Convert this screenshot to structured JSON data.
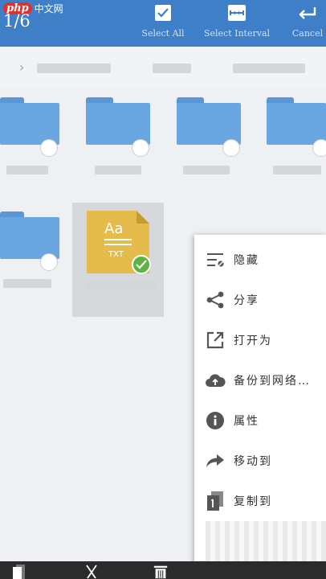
{
  "watermark": {
    "badge": "php",
    "text": "中文网"
  },
  "selection": {
    "counter": "1/6"
  },
  "toolbar": {
    "select_all": {
      "label": "Select All",
      "icon": "checkbox-icon"
    },
    "select_interval": {
      "label": "Select Interval",
      "icon": "interval-icon"
    },
    "cancel": {
      "label": "Cancel",
      "icon": "return-arrow-icon"
    }
  },
  "files": {
    "selected_file": {
      "type": "TXT",
      "glyph": "Aa"
    }
  },
  "context_menu": {
    "items": [
      {
        "label": "隐藏",
        "icon": "hide-icon"
      },
      {
        "label": "分享",
        "icon": "share-icon"
      },
      {
        "label": "打开为",
        "icon": "open-as-icon"
      },
      {
        "label": "备份到网络…",
        "icon": "cloud-upload-icon"
      },
      {
        "label": "属性",
        "icon": "info-icon"
      },
      {
        "label": "移动到",
        "icon": "move-icon"
      },
      {
        "label": "复制到",
        "icon": "copy-icon"
      }
    ]
  },
  "bottom_bar": {
    "icons": [
      "copy-icon",
      "cut-icon",
      "delete-icon"
    ]
  },
  "colors": {
    "toolbar": "#3f7fc8",
    "folder": "#6aa6e0",
    "txt_file": "#e5bc4b",
    "check": "#5ab43e"
  }
}
